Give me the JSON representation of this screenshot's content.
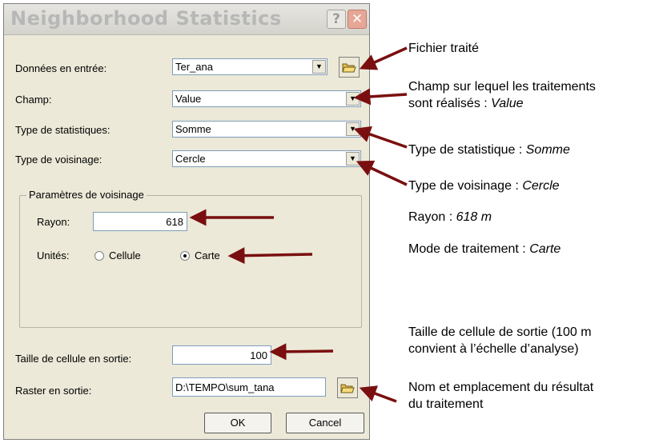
{
  "dialog": {
    "title": "Neighborhood Statistics",
    "help_label": "?",
    "close_label": "✕"
  },
  "fields": {
    "input_label": "Données en entrée:",
    "input_value": "Ter_ana",
    "field_label": "Champ:",
    "field_value": "Value",
    "stat_label": "Type de statistiques:",
    "stat_value": "Somme",
    "neigh_label": "Type de voisinage:",
    "neigh_value": "Cercle"
  },
  "neighborhood": {
    "group_label": "Paramètres de voisinage",
    "radius_label": "Rayon:",
    "radius_value": "618",
    "units_label": "Unités:",
    "unit_cell": "Cellule",
    "unit_map": "Carte",
    "selected_unit": "Carte"
  },
  "output": {
    "cellsize_label": "Taille de cellule en sortie:",
    "cellsize_value": "100",
    "raster_label": "Raster en sortie:",
    "raster_value": "D:\\TEMPO\\sum_tana"
  },
  "buttons": {
    "ok": "OK",
    "cancel": "Cancel"
  },
  "annotations": {
    "a1": "Fichier traité",
    "a2_line1": "Champ sur lequel les traitements",
    "a2_line2": "sont réalisés : ",
    "a2_value": "Value",
    "a3": "Type de statistique : ",
    "a3_value": "Somme",
    "a4": "Type de voisinage : ",
    "a4_value": "Cercle",
    "a5": "Rayon : ",
    "a5_value": "618 m",
    "a6": "Mode de traitement : ",
    "a6_value": "Carte",
    "a7_line1": "Taille de cellule de sortie (100 m",
    "a7_line2": "convient à l’échelle d’analyse)",
    "a8_line1": "Nom et emplacement du résultat",
    "a8_line2": "du traitement"
  },
  "colors": {
    "arrow": "#7a0f0f",
    "dialog_bg": "#ece9d8"
  }
}
